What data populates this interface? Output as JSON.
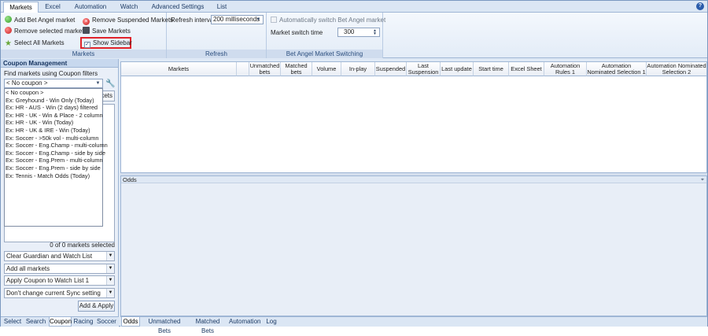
{
  "tabs": [
    "Markets",
    "Excel",
    "Automation",
    "Watch",
    "Advanced Settings",
    "List"
  ],
  "help_label": "?",
  "ribbon": {
    "markets_group": {
      "label": "Markets",
      "add_bet_angel_market": "Add Bet Angel market",
      "remove_selected_markets": "Remove selected markets",
      "select_all_markets": "Select All Markets",
      "remove_suspended_markets": "Remove Suspended Markets",
      "save_markets": "Save Markets",
      "show_sidebar": "Show Sidebar",
      "show_sidebar_checked": "✓"
    },
    "refresh_group": {
      "label": "Refresh",
      "refresh_interval_label": "Refresh interval",
      "refresh_interval_value": "200 milliseconds"
    },
    "switch_group": {
      "label": "Bet Angel Market Switching",
      "auto_switch_label": "Automatically switch Bet Angel market",
      "market_switch_time_label": "Market switch time",
      "market_switch_time_value": "300"
    }
  },
  "sidebar": {
    "title": "Coupon Management",
    "find_label": "Find markets using Coupon filters",
    "coupon_selected": "< No coupon >",
    "coupon_options": [
      "< No coupon >",
      "Ex: Greyhound - Win Only (Today)",
      "Ex: HR - AUS - Win (2 days) filtered",
      "Ex: HR - UK - Win & Place - 2 column",
      "Ex: HR - UK - Win (Today)",
      "Ex: HR - UK & IRE - Win (Today)",
      "Ex: Soccer - >50k vol - multi-column",
      "Ex: Soccer - Eng.Champ - multi-column",
      "Ex: Soccer - Eng.Champ - side by side",
      "Ex: Soccer - Eng.Prem - multi-column",
      "Ex: Soccer - Eng.Prem - side by side",
      "Ex: Tennis - Match Odds (Today)"
    ],
    "hidden_button_label": "kets",
    "markets_count": "0 of 0 markets selected",
    "combo1": "Clear Guardian and Watch List",
    "combo2": "Add all markets",
    "combo3": "Apply Coupon to Watch List 1",
    "combo4": "Don't change current Sync setting",
    "add_apply": "Add & Apply"
  },
  "left_bottom_tabs": [
    "Select",
    "Search",
    "Coupon",
    "Racing",
    "Soccer"
  ],
  "grid_columns": [
    "Markets",
    "",
    "Unmatched bets",
    "Matched bets",
    "Volume",
    "In-play",
    "Suspended",
    "Last Suspension",
    "Last update",
    "Start time",
    "Excel Sheet",
    "Automation Rules 1",
    "Automation Nominated Selection 1",
    "Automation Nominated Selection 2"
  ],
  "odds_title": "Odds",
  "right_bottom_tabs": [
    "Odds",
    "Unmatched Bets",
    "Matched Bets",
    "Automation",
    "Log"
  ],
  "icons": {
    "add": "green-plus-icon",
    "remove": "red-minus-icon",
    "select_all": "star-icon",
    "remove_suspended": "red-x-icon",
    "save": "floppy-disk-icon",
    "wrench": "wrench-icon",
    "pin": "pin-icon"
  }
}
